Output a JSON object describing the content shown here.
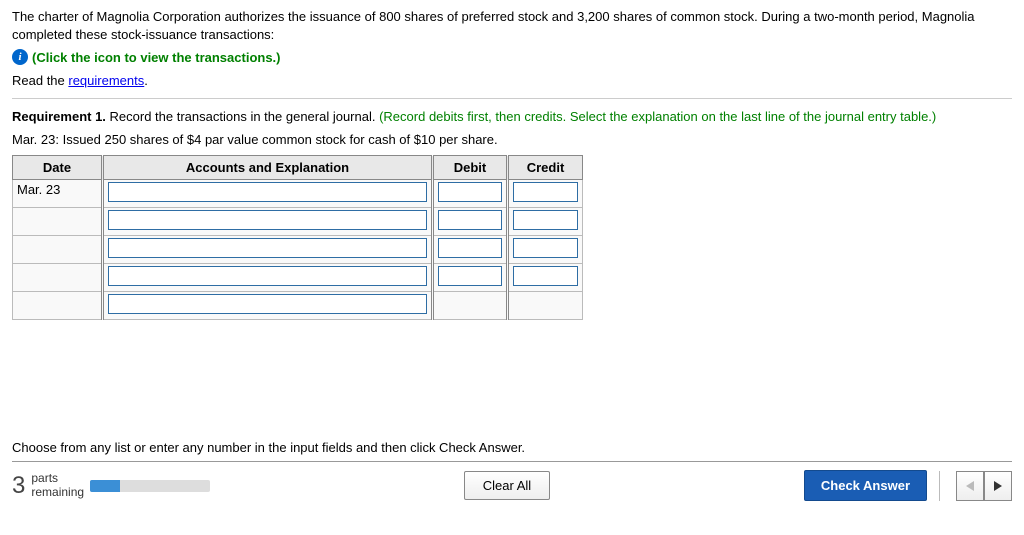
{
  "problem": {
    "intro": "The charter of Magnolia Corporation authorizes the issuance of 800 shares of preferred stock and 3,200 shares of common stock. During a two-month period, Magnolia completed these stock-issuance transactions:",
    "view_transactions": "(Click the icon to view the transactions.)",
    "read_the": "Read the ",
    "requirements_link": "requirements",
    "period": "."
  },
  "requirement": {
    "label": "Requirement 1.",
    "text": " Record the transactions in the general journal. ",
    "instruction": "(Record debits first, then credits. Select the explanation on the last line of the journal entry table.)"
  },
  "transaction": "Mar. 23: Issued 250 shares of $4 par value common stock for cash of $10 per share.",
  "table": {
    "headers": {
      "date": "Date",
      "accounts": "Accounts and Explanation",
      "debit": "Debit",
      "credit": "Credit"
    },
    "rows": [
      {
        "date": "Mar. 23",
        "has_debit": true,
        "has_credit": true
      },
      {
        "date": "",
        "has_debit": true,
        "has_credit": true
      },
      {
        "date": "",
        "has_debit": true,
        "has_credit": true
      },
      {
        "date": "",
        "has_debit": true,
        "has_credit": true
      },
      {
        "date": "",
        "has_debit": false,
        "has_credit": false
      }
    ]
  },
  "footer": {
    "choose": "Choose from any list or enter any number in the input fields and then click Check Answer.",
    "parts_num": "3",
    "parts_label_top": "parts",
    "parts_label_bottom": "remaining",
    "clear_all": "Clear All",
    "check_answer": "Check Answer"
  }
}
